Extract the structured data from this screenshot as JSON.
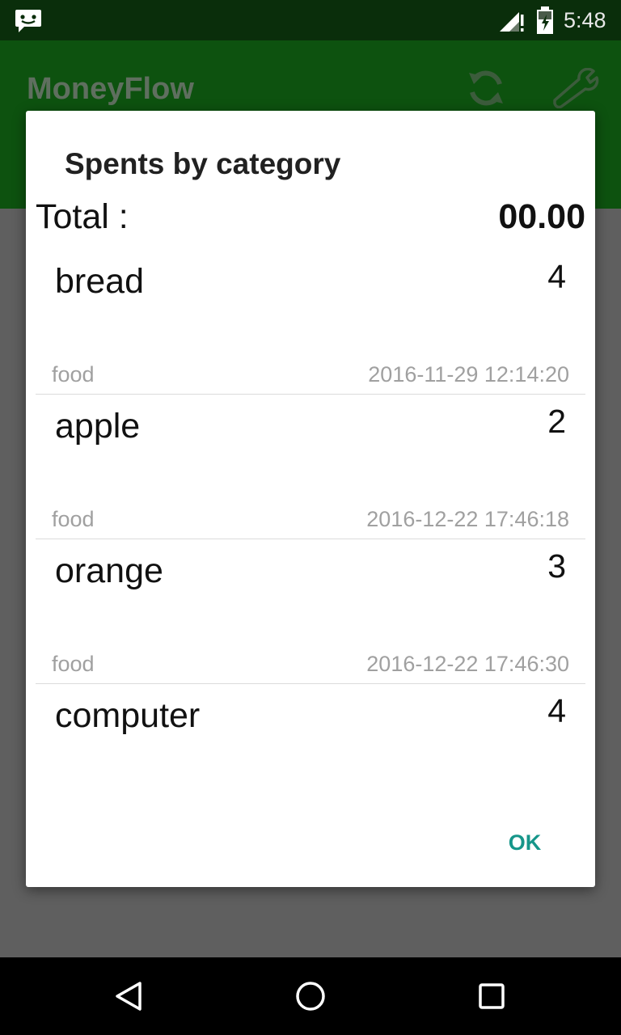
{
  "status_bar": {
    "time": "5:48",
    "icons": [
      "notification-message-icon",
      "signal-icon",
      "battery-icon"
    ]
  },
  "app_bar": {
    "title": "MoneyFlow",
    "actions": [
      "refresh-icon",
      "wrench-icon"
    ]
  },
  "dialog": {
    "title": "Spents by category",
    "total_label": "Total :",
    "total_value": "00.00",
    "items": [
      {
        "name": "bread",
        "amount": "4",
        "category": "food",
        "date": "2016-11-29 12:14:20"
      },
      {
        "name": "apple",
        "amount": "2",
        "category": "food",
        "date": "2016-12-22 17:46:18"
      },
      {
        "name": "orange",
        "amount": "3",
        "category": "food",
        "date": "2016-12-22 17:46:30"
      },
      {
        "name": "computer",
        "amount": "4",
        "category": "",
        "date": ""
      }
    ],
    "ok_label": "OK"
  },
  "colors": {
    "status_bar": "#0a2e0b",
    "app_bar": "#0d520f",
    "accent": "#16968a",
    "scrim": "#5f5f5f"
  },
  "nav_bar": {
    "buttons": [
      "back-icon",
      "home-icon",
      "recents-icon"
    ]
  }
}
